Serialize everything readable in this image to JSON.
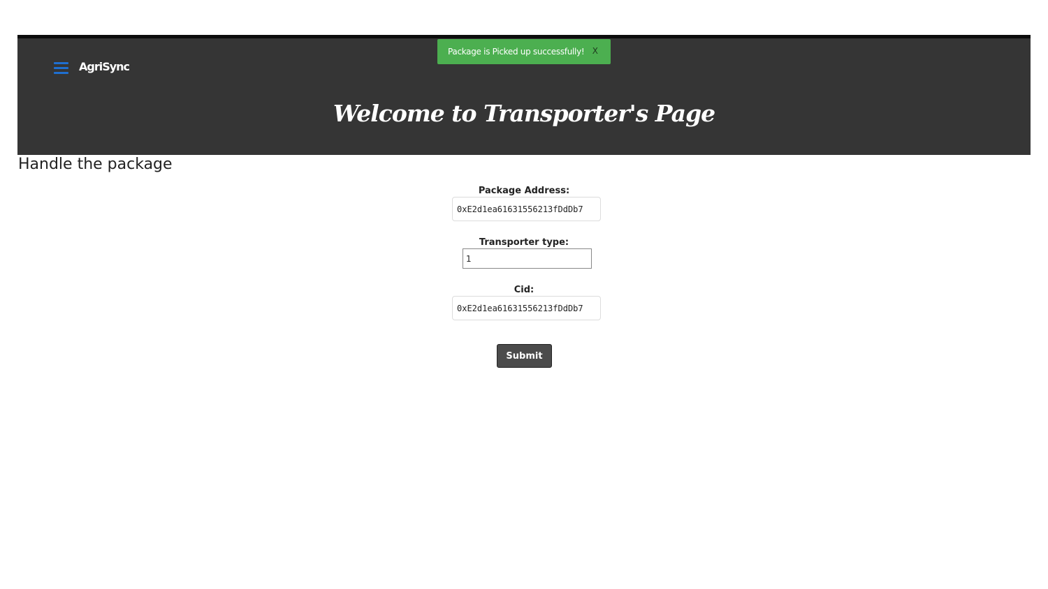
{
  "header": {
    "brand": "AgriSync",
    "welcome": "Welcome to Transporter's Page"
  },
  "toast": {
    "message": "Package is Picked up successfully!",
    "close_label": "X"
  },
  "form": {
    "title": "Handle the package",
    "package_address_label": "Package Address:",
    "package_address_value": "0xE2d1ea61631556213fDdDb7",
    "transporter_type_label": "Transporter type:",
    "transporter_type_value": "1",
    "cid_label": "Cid:",
    "cid_value": "0xE2d1ea61631556213fDdDb7",
    "submit_label": "Submit"
  },
  "colors": {
    "header_bg": "#353535",
    "toast_bg": "#4caf50",
    "menu_icon": "#1f6fd0",
    "button_bg": "#4b4b4b"
  }
}
